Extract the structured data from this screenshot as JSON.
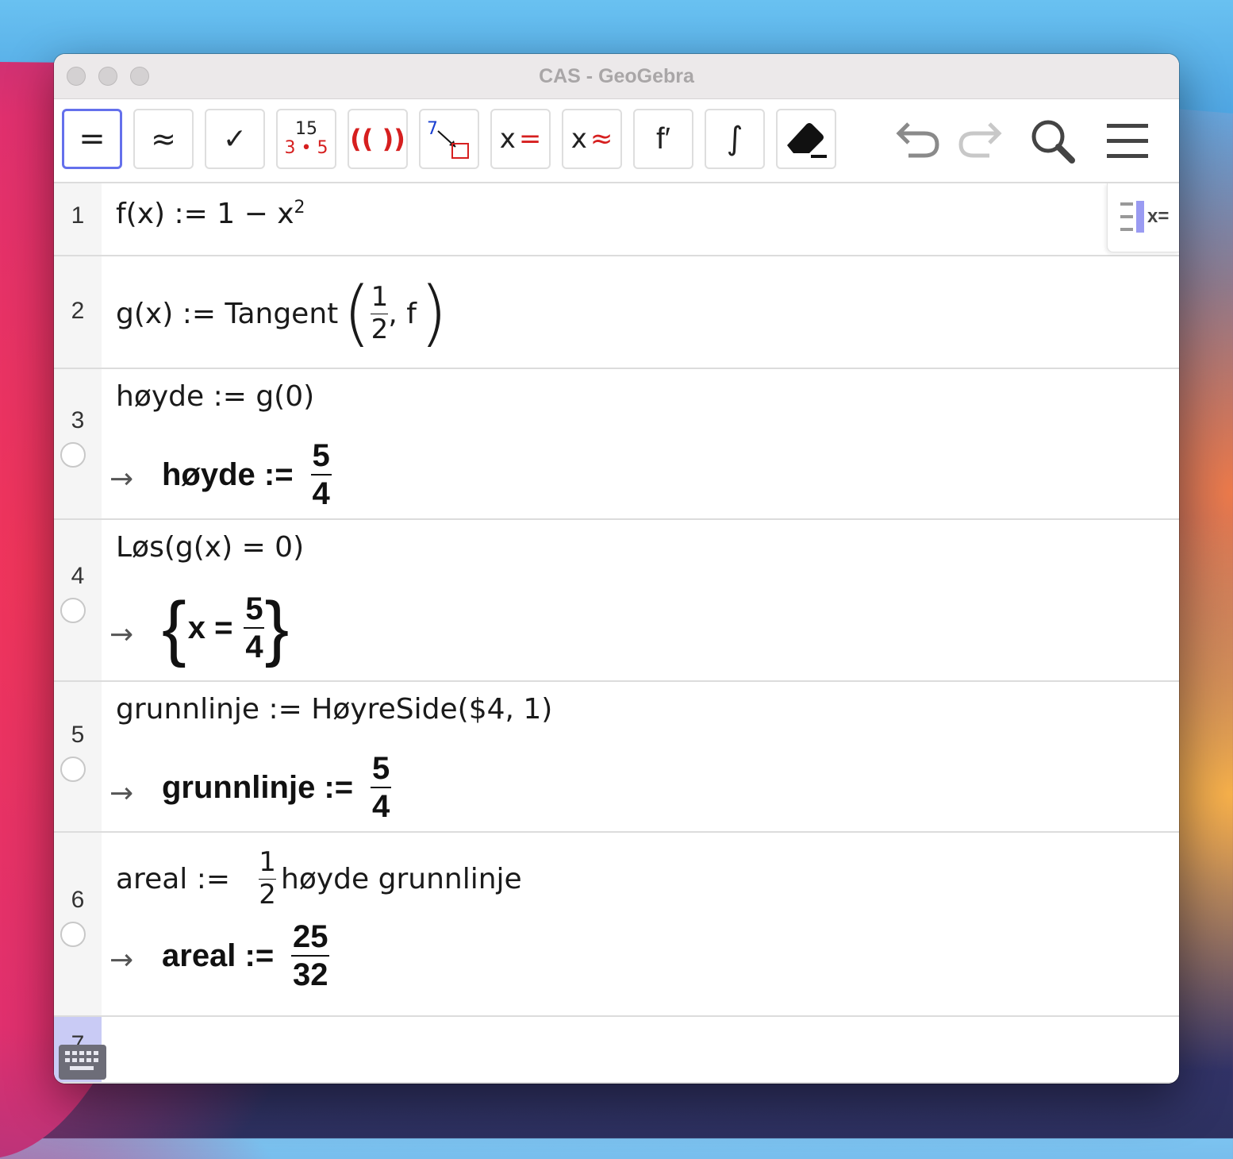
{
  "window": {
    "title": "CAS - GeoGebra"
  },
  "toolbar": {
    "buttons": [
      {
        "name": "evaluate",
        "label": "="
      },
      {
        "name": "numeric",
        "label": "≈"
      },
      {
        "name": "keep-input",
        "label": "✓"
      },
      {
        "name": "factor",
        "label_top": "15",
        "label_bottom": "3 • 5"
      },
      {
        "name": "expand",
        "label": "(( ))"
      },
      {
        "name": "substitute",
        "label": "7"
      },
      {
        "name": "solve",
        "label_x": "x",
        "label_sym": "="
      },
      {
        "name": "solve-numerically",
        "label_x": "x",
        "label_sym": "≈"
      },
      {
        "name": "derivative",
        "label": "f′"
      },
      {
        "name": "integral",
        "label": "∫"
      },
      {
        "name": "delete",
        "label": ""
      }
    ],
    "icons": [
      "undo-icon",
      "redo-icon",
      "search-icon",
      "menu-icon"
    ]
  },
  "rows": [
    {
      "number": "1",
      "input": "f(x) := 1 − x",
      "input_sup": "2"
    },
    {
      "number": "2",
      "input_prefix": "g(x) := Tangent",
      "input_frac_num": "1",
      "input_frac_den": "2",
      "input_suffix": ", f"
    },
    {
      "number": "3",
      "input": "høyde := g(0)",
      "output_prefix": "høyde :=",
      "output_num": "5",
      "output_den": "4"
    },
    {
      "number": "4",
      "input": "Løs(g(x)  =  0)",
      "output_prefix": "x =",
      "output_num": "5",
      "output_den": "4"
    },
    {
      "number": "5",
      "input": "grunnlinje  := HøyreSide($4,  1)",
      "output_prefix": "grunnlinje :=",
      "output_num": "5",
      "output_den": "4"
    },
    {
      "number": "6",
      "input_prefix": "areal :=",
      "input_frac_num": "1",
      "input_frac_den": "2",
      "input_suffix": "høyde grunnlinje",
      "output_prefix": "areal :=",
      "output_num": "25",
      "output_den": "32"
    },
    {
      "number": "7"
    }
  ],
  "arrow": "→",
  "side_toggle_label": "x="
}
